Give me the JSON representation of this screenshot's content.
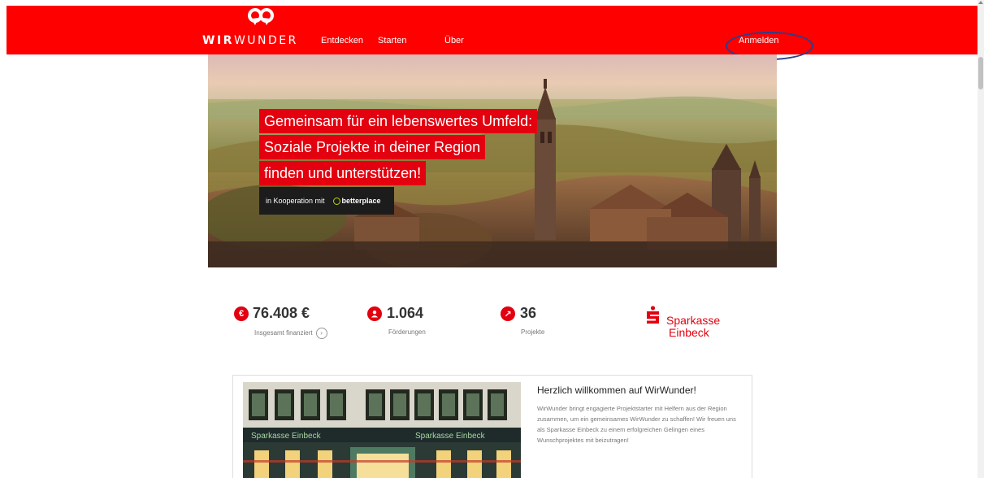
{
  "header": {
    "logo_bold": "WIR",
    "logo_light": "WUNDER",
    "nav": [
      {
        "label": "Entdecken"
      },
      {
        "label": "Starten"
      },
      {
        "label": "Über"
      }
    ],
    "login_label": "Anmelden",
    "bg_color": "#ff0000",
    "annotation_color": "#2c3e8c"
  },
  "hero": {
    "lines": [
      "Gemeinsam für ein lebenswertes Umfeld:",
      "Soziale Projekte in deiner Region",
      "finden und unterstützen!"
    ],
    "cooperation_label": "in Kooperation mit",
    "partner_name": "betterplace",
    "accent_color": "#e3000f"
  },
  "stats": [
    {
      "icon": "euro-icon",
      "symbol": "€",
      "value": "76.408 €",
      "label": "Insgesamt finanziert",
      "info_symbol": "›"
    },
    {
      "icon": "person-icon",
      "symbol": "",
      "value": "1.064",
      "label": "Förderungen"
    },
    {
      "icon": "arrow-icon",
      "symbol": "↗",
      "value": "36",
      "label": "Projekte"
    }
  ],
  "sponsor": {
    "line1": "Sparkasse",
    "line2": "Einbeck",
    "logo_icon": "sparkasse-s-icon"
  },
  "welcome": {
    "title": "Herzlich willkommen auf WirWunder!",
    "body": "WirWunder bringt engagierte Projektstarter mit Helfern aus der Region zusammen, um ein gemeinsames WirWunder zu schaffen! Wir freuen uns als Sparkasse Einbeck zu einem erfolgreichen Gelingen eines Wunschprojektes mit beizutragen!",
    "sign_left": "Sparkasse Einbeck",
    "sign_right": "Sparkasse Einbeck"
  }
}
